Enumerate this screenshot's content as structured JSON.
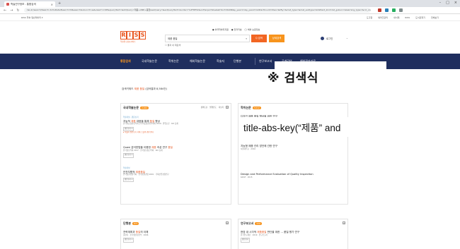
{
  "browser": {
    "tab_title": "학술연구정보 - 통합검색",
    "url": "riss.kr/search/Search.do?isDetailSearch=N&searchGubun=true&viewYn=OP&queryText=&strQuery=제품+AND+품질&exQuery=&exQueryText=&order=%2FDESC&onHanja=false&strSort=RANK&p_year1=&p_year2=&iStartCount=0&orderBy=&mat_type=&mat_subtype=&fulltext_kind=&t_gubun=&learning_type=&ccl_code=&inside_outside=&fric_yn=&image_yn=&gubun=&kdc=&ttsUseYn=&l_sub_code=&fsearchMethod=search&sflag=1&isFDetailSearch=N&pageNumber=1&resultKeyword=&fsearchSort=&fsearchOrder=&limiterList=&limiterListText=&facetList=&facetListText=&fsearchDB=&icate=re_a_kor&colName=re_a_kor&pageScale=10&isTab=Y&regnm=&dorg_storage=&language=&language_code=&clickKeyword=&relationKeyword=&query=제품+품질",
    "bookmark": "RISS 학술 일반데이터 ▾",
    "right_bookmarks": [
      "도구함",
      "북마크관리",
      "내서재",
      "RISS",
      "도서관찾기",
      "전체보기"
    ]
  },
  "header": {
    "logo_letters": [
      "R",
      "I",
      "S",
      "S"
    ],
    "logo_sub": "학술연구정보서비스",
    "quick_links": [
      "● 외국학술지지원",
      "● 전자저널",
      "◯ 해외 논문정보"
    ],
    "search_value": "제품 품질",
    "search_btn": "Q 검색",
    "detail_btn": "상세검색",
    "within_label": "☐ 결과 내 재검색",
    "user_label": "로그인"
  },
  "menu": {
    "items": [
      "통합검색",
      "국내학술논문",
      "학위논문",
      "해외학술논문",
      "학술지",
      "단행본",
      "연구보고서",
      "공개강의",
      "해외전자자료"
    ]
  },
  "annotation": {
    "title": "※ 검색식",
    "query": "title-abs-key(“제품” and"
  },
  "results": {
    "summary_prefix": "검색키워드 ",
    "summary_keyword": "제품 품질",
    "summary_suffix": " (검색결과 8,584건)",
    "domestic": {
      "title": "국내학술논문",
      "count": "2,462",
      "tools": [
        "정확도순",
        "발행년도",
        "더보기"
      ],
      "items": [
        {
          "tag": "학술저널 · 원문보기",
          "title_a": "지능적 ",
          "title_hl": "제품",
          "title_b": " 대응을 통해 ",
          "title_hl2": "품질",
          "title_c": " 향상",
          "meta": "한국지능형물류학회 한국지능형물류학회지 2019 · 졸업논문 · KCI 등재",
          "btn": "원문보기 ▾",
          "note": "▸ 학술지 원문보기 서비스 발행 관련 안내"
        },
        {
          "tag": "",
          "title_a": "Quasi 분석방법을 이용한 ",
          "title_hl": "제품",
          "title_b": " 속성 연구 ",
          "title_hl2": "품질",
          "title_c": "",
          "meta": "한국정보학회 2017 · 한국정보통신학회 · KCI 등재",
          "btn": "원문보기 ▾",
          "note": ""
        },
        {
          "tag": "학술저널",
          "title_a": "안전지향적 ",
          "title_hl": "제품",
          "title_b": "",
          "title_hl2": "품질",
          "title_c": "",
          "meta": "한국품질경영학회 · 한국품질경영 2001 · 국제산업경영연구",
          "btn": "원문보기 ▾",
          "note": ""
        }
      ]
    },
    "thesis": {
      "title": "학위논문",
      "count": "3,012",
      "items": [
        {
          "title": "디자인 제품 품질 향상을 위한 연구",
          "meta": "한국대학교 · 2018"
        },
        {
          "title": "지능형 제품 관리 방안에 관한 연구",
          "meta": "서울대학교 · 2016"
        },
        {
          "title": "Design and Performance Evaluation of Quality Inspection",
          "meta": "KAIST · 2015"
        }
      ]
    },
    "book": {
      "title": "단행본",
      "count": "871",
      "item_a": "전략계획과 ",
      "item_hl": "품질",
      "item_b": "의 이해",
      "meta": "출판사 · 한국생산성본부 · 2006",
      "btn": "원문보기 ▾"
    },
    "report": {
      "title": "연구보고서",
      "count": "239",
      "item_a": "현장 내 시각적 ",
      "item_hl": "제품품질",
      "item_b": " 판단을 위한 ... 품질 평가 연구",
      "meta": "한국연구재단 · 2019 · 연구보고서",
      "btn": "원문보기"
    }
  }
}
